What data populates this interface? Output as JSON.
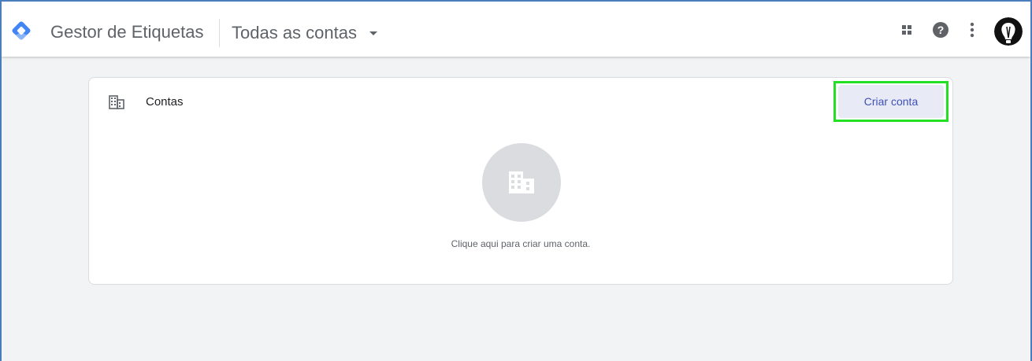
{
  "app": {
    "product_name": "Gestor de Etiquetas",
    "account_switcher_label": "Todas as contas"
  },
  "icons": {
    "logo": "gtm-diamond-logo",
    "apps": "apps-grid-icon",
    "help": "help-icon",
    "more": "more-vert-icon",
    "avatar": "user-avatar"
  },
  "accounts_card": {
    "title": "Contas",
    "create_button_label": "Criar conta",
    "empty_message": "Clique aqui para criar uma conta."
  },
  "colors": {
    "brand_blue": "#4285f4",
    "accent_blue": "#3f51b5",
    "highlight_green": "#24e024"
  }
}
